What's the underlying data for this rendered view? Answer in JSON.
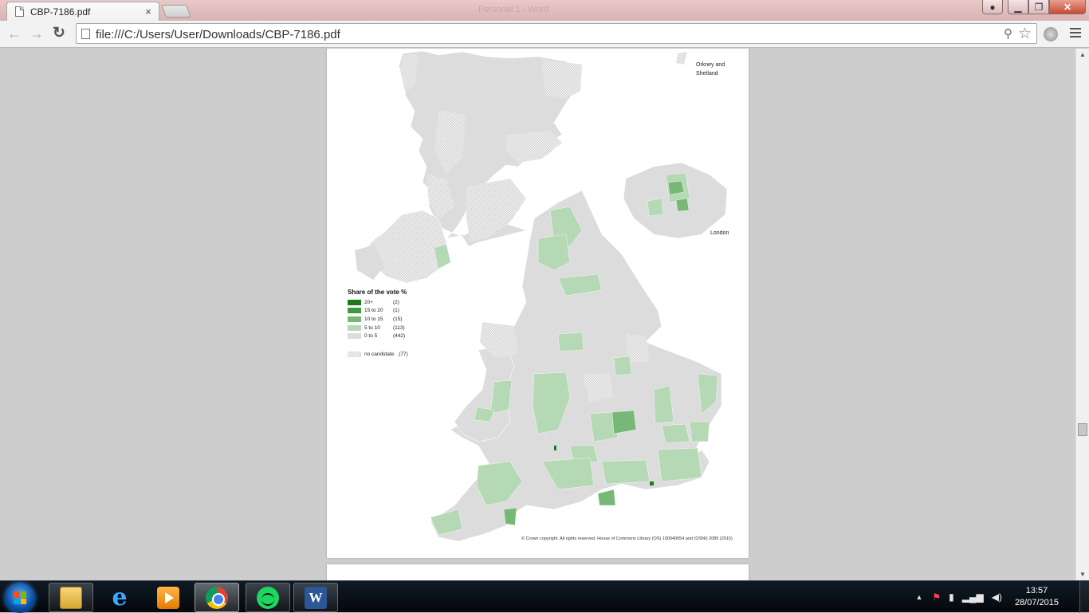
{
  "browser": {
    "tab_title": "CBP-7186.pdf",
    "tab_close": "×",
    "window_title": "Personal 1 - Word",
    "url": "file:///C:/Users/User/Downloads/CBP-7186.pdf",
    "controls": {
      "minimize": "▁",
      "maximize": "❐",
      "close": "✕"
    }
  },
  "map": {
    "inset_orkney": "Orkney and Shetland",
    "inset_london": "London",
    "legend_title": "Share of the vote %",
    "legend": [
      {
        "label": "20+",
        "count": "(2)",
        "color": "#1c7a1c"
      },
      {
        "label": "15  to  20",
        "count": "(1)",
        "color": "#3d9a3d"
      },
      {
        "label": "10  to  15",
        "count": "(15)",
        "color": "#77b877"
      },
      {
        "label": "5  to  10",
        "count": "(113)",
        "color": "#b5d9b5"
      },
      {
        "label": "0  to    5",
        "count": "(442)",
        "color": "#dcdcdc"
      }
    ],
    "no_candidate_label": "no candidate",
    "no_candidate_count": "(77)",
    "copyright": "© Crown copyright. All rights reserved. House of Commons Library (OS) 100040654 and (OSNI) 2085 (2015)"
  },
  "taskbar": {
    "apps": [
      "file-explorer",
      "internet-explorer",
      "media-player",
      "chrome",
      "spotify",
      "word"
    ],
    "clock_time": "13:57",
    "clock_date": "28/07/2015"
  }
}
